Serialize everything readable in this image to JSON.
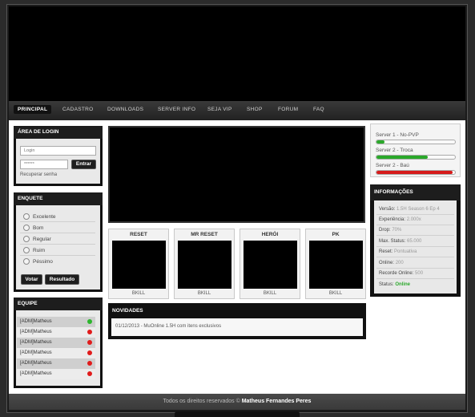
{
  "nav": [
    "PRINCIPAL",
    "CADASTRO",
    "DOWNLOADS",
    "SERVER INFO",
    "SEJA VIP",
    "SHOP",
    "FORUM",
    "FAQ"
  ],
  "login": {
    "title": "ÁREA DE LOGIN",
    "login_placeholder": "Login",
    "password_placeholder": "******",
    "submit": "Entrar",
    "recover": "Recuperar senha"
  },
  "poll": {
    "title": "ENQUETE",
    "options": [
      "Excelente",
      "Bom",
      "Regular",
      "Ruim",
      "Péssimo"
    ],
    "vote": "Votar",
    "results": "Resultado"
  },
  "team": {
    "title": "EQUIPE",
    "members": [
      {
        "name": "[ADM]Matheus",
        "status": "online",
        "color": "#2db52d"
      },
      {
        "name": "[ADM]Matheus",
        "status": "offline",
        "color": "#e01b1b"
      },
      {
        "name": "[ADM]Matheus",
        "status": "offline",
        "color": "#e01b1b"
      },
      {
        "name": "[ADM]Matheus",
        "status": "offline",
        "color": "#e01b1b"
      },
      {
        "name": "[ADM]Matheus",
        "status": "offline",
        "color": "#e01b1b"
      },
      {
        "name": "[ADM]Matheus",
        "status": "offline",
        "color": "#e01b1b"
      }
    ]
  },
  "rankings": [
    {
      "title": "RESET",
      "footer": "BKILL"
    },
    {
      "title": "MR RESET",
      "footer": "BKILL"
    },
    {
      "title": "HERÓI",
      "footer": "BKILL"
    },
    {
      "title": "PK",
      "footer": "BKILL"
    }
  ],
  "news": {
    "title": "NOVIDADES",
    "item": "01/12/2013 - MuOnline 1.5H com itens exclusivos"
  },
  "servers": [
    {
      "name": "Server 1 - No-PVP",
      "load": 0.1,
      "color": "#2aa82a"
    },
    {
      "name": "Server 2 - Troca",
      "load": 0.65,
      "color": "#2aa82a"
    },
    {
      "name": "Server 2 - Baú",
      "load": 0.97,
      "color": "#d61b1b"
    }
  ],
  "info": {
    "title": "INFORMAÇÕES",
    "rows": [
      {
        "label": "Versão: ",
        "value": "1.5H Season 6 Ep 4"
      },
      {
        "label": "Experiência: ",
        "value": "2.000x"
      },
      {
        "label": "Drop: ",
        "value": "70%"
      },
      {
        "label": "Max. Status: ",
        "value": "65.000"
      },
      {
        "label": "Reset: ",
        "value": "Pontuativa"
      },
      {
        "label": "Online: ",
        "value": "200"
      },
      {
        "label": "Recorde Online: ",
        "value": "500"
      }
    ],
    "status_label": "Status: ",
    "status_value": "Online"
  },
  "footer": {
    "text": "Todos os direitos reservados © ",
    "author": "Matheus Fernandes Peres"
  }
}
